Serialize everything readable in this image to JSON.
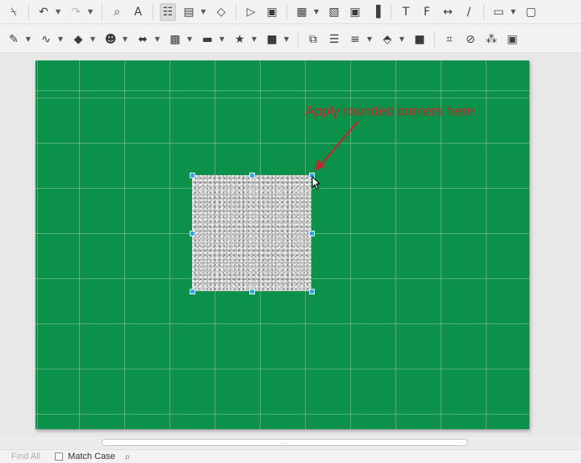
{
  "toolbar_main": {
    "icons": [
      {
        "name": "clear-formatting-icon",
        "glyph": "⍀",
        "disabled": false
      },
      {
        "name": "undo-icon",
        "glyph": "↶",
        "disabled": false
      },
      {
        "name": "redo-icon",
        "glyph": "↷",
        "disabled": true
      },
      {
        "name": "zoom-icon",
        "glyph": "⌕",
        "disabled": false
      },
      {
        "name": "fontwork-icon",
        "glyph": "A",
        "disabled": false
      },
      {
        "name": "display-grid-icon",
        "glyph": "☷",
        "disabled": false
      },
      {
        "name": "slide-layout-icon",
        "glyph": "▤",
        "disabled": false
      },
      {
        "name": "helplines-icon",
        "glyph": "◇",
        "disabled": false
      },
      {
        "name": "start-slideshow-icon",
        "glyph": "▷",
        "disabled": false
      },
      {
        "name": "slideshow-current-icon",
        "glyph": "▣",
        "disabled": false
      },
      {
        "name": "table-icon",
        "glyph": "▦",
        "disabled": false
      },
      {
        "name": "insert-image-icon",
        "glyph": "▧",
        "disabled": false
      },
      {
        "name": "media-icon",
        "glyph": "▣",
        "disabled": false
      },
      {
        "name": "insert-chart-icon",
        "glyph": "▐",
        "disabled": false
      },
      {
        "name": "text-box-icon",
        "glyph": "T",
        "disabled": false
      },
      {
        "name": "fontwork-gallery-icon",
        "glyph": "F",
        "disabled": false
      },
      {
        "name": "toggle-points-icon",
        "glyph": "↔",
        "disabled": false
      },
      {
        "name": "draw-functions-icon",
        "glyph": "∕",
        "disabled": false
      },
      {
        "name": "comment-icon",
        "glyph": "▭",
        "disabled": false
      },
      {
        "name": "show-changes-icon",
        "glyph": "▢",
        "disabled": false
      }
    ]
  },
  "toolbar_drawing": {
    "icons": [
      {
        "name": "line-color-icon",
        "glyph": "✎"
      },
      {
        "name": "curve-icon",
        "glyph": "∿"
      },
      {
        "name": "basic-shapes-icon",
        "glyph": "◆"
      },
      {
        "name": "symbol-shapes-icon",
        "glyph": "☻"
      },
      {
        "name": "block-arrows-icon",
        "glyph": "⬌"
      },
      {
        "name": "flowchart-icon",
        "glyph": "▩"
      },
      {
        "name": "callouts-icon",
        "glyph": "▬"
      },
      {
        "name": "stars-icon",
        "glyph": "★"
      },
      {
        "name": "3d-objects-icon",
        "glyph": "■"
      },
      {
        "name": "transformations-icon",
        "glyph": "⧉"
      },
      {
        "name": "align-objects-icon",
        "glyph": "☰"
      },
      {
        "name": "arrange-icon",
        "glyph": "≡"
      },
      {
        "name": "distribute-icon",
        "glyph": "⬘"
      },
      {
        "name": "shadow-icon",
        "glyph": "■"
      },
      {
        "name": "crop-icon",
        "glyph": "⌗"
      },
      {
        "name": "filter-icon",
        "glyph": "⊘"
      },
      {
        "name": "gluepoint-icon",
        "glyph": "⁂"
      },
      {
        "name": "toggle-extrusion-icon",
        "glyph": "▣"
      }
    ]
  },
  "slide": {
    "background_color": "#0b914a",
    "annotation_text": "Apply rounded corners here",
    "annotation_color": "#c4262e",
    "selection_handle_color": "#3ba0e6"
  },
  "findbar": {
    "find_all_label": "Find All",
    "match_case_label": "Match Case",
    "match_case_checked": false,
    "search_icon": "search-icon"
  }
}
